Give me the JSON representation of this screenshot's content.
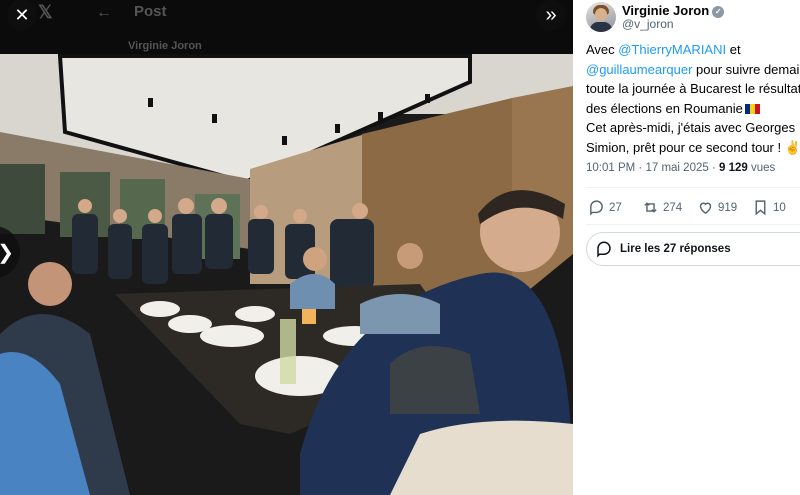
{
  "viewer": {
    "ghost_title": "Post",
    "ghost_author": "Virginie Joron",
    "photo_alt": "Photo",
    "icons": {
      "close": "close-icon",
      "collapse": "double-chevron-right-icon",
      "prev": "chevron-left-icon",
      "back": "arrow-left-icon"
    },
    "close_glyph": "✕",
    "collapse_glyph": "»",
    "prev_glyph": "❮"
  },
  "author": {
    "name": "Virginie Joron",
    "handle": "@v_joron",
    "verified_glyph": "✓"
  },
  "tweet": {
    "line1_pre": "Avec ",
    "mention1": "@ThierryMARIANI",
    "line1_post": " et",
    "mention2": "@guillaumearquer",
    "line2_post": " pour suivre demain",
    "line3": "toute la journée à Bucarest le résultat",
    "line4": "des élections en Roumanie",
    "line5": "Cet après-midi, j'étais avec Georges",
    "line6": "Simion, prêt pour ce second tour ! ✌",
    "flag_colors": [
      "#002b7f",
      "#fcd116",
      "#ce1126"
    ]
  },
  "meta": {
    "time": "10:01 PM",
    "sep": " · ",
    "date": "17 mai 2025",
    "views_count": "9 129",
    "views_label": " vues"
  },
  "actions": {
    "replies": "27",
    "reposts": "274",
    "likes": "919",
    "bookmarks": "10"
  },
  "read_replies": "Lire les 27 réponses",
  "colors": {
    "accent": "#1d9bf0",
    "muted": "#536471"
  }
}
